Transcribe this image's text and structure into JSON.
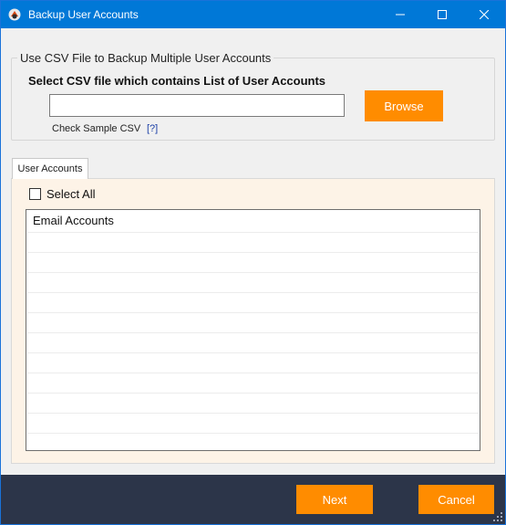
{
  "window": {
    "title": "Backup User Accounts",
    "titlebar_color": "#0078d7",
    "icons": {
      "app": "app-logo-icon",
      "minimize": "minimize-icon",
      "maximize": "maximize-icon",
      "close": "close-icon"
    }
  },
  "csv_group": {
    "legend": "Use CSV File to Backup Multiple User Accounts",
    "heading": "Select CSV file which contains List of User Accounts",
    "input_value": "",
    "browse_label": "Browse",
    "sample_label": "Check Sample CSV",
    "sample_help": "[?]"
  },
  "tabs": [
    {
      "label": "User Accounts",
      "active": true
    }
  ],
  "accounts": {
    "select_all_label": "Select All",
    "select_all_checked": false,
    "column_header": "Email Accounts",
    "rows": []
  },
  "footer": {
    "next_label": "Next",
    "cancel_label": "Cancel",
    "background": "#2c3549",
    "accent": "#ff8c00"
  }
}
